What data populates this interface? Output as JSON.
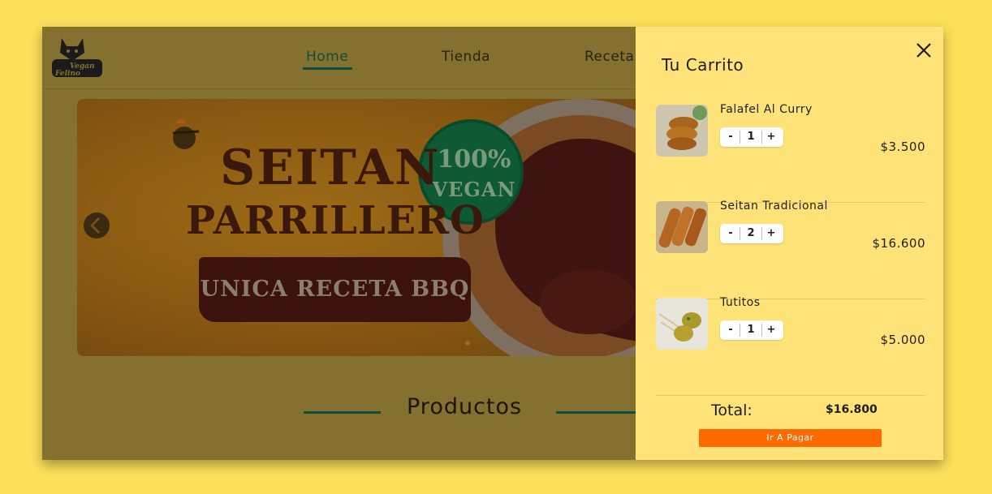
{
  "nav": {
    "links": [
      "Home",
      "Tienda",
      "Receta"
    ],
    "logo_text_1": "Vegan",
    "logo_text_2": "Felino"
  },
  "banner": {
    "line1": "SEITAN",
    "line2": "PARRILLERO",
    "badge_line1": "100%",
    "badge_line2": "VEGAN",
    "tagline": "UNICA RECETA BBQ"
  },
  "products": {
    "title": "Productos"
  },
  "cart": {
    "title": "Tu Carrito",
    "items": [
      {
        "name": "Falafel Al Curry",
        "qty": "1",
        "price": "$3.500",
        "minus": "-",
        "plus": "+"
      },
      {
        "name": "Seitan Tradicional",
        "qty": "2",
        "price": "$16.600",
        "minus": "-",
        "plus": "+"
      },
      {
        "name": "Tutitos",
        "qty": "1",
        "price": "$5.000",
        "minus": "-",
        "plus": "+"
      }
    ],
    "total_label": "Total:",
    "total_value": "$16.800",
    "pay_label": "Ir A Pagar"
  },
  "colors": {
    "background": "#fde05a",
    "overlay": "#84702f",
    "cart_bg": "#ffe378",
    "accent_green": "#0f4f3f",
    "pay_orange": "#ff6a00"
  }
}
